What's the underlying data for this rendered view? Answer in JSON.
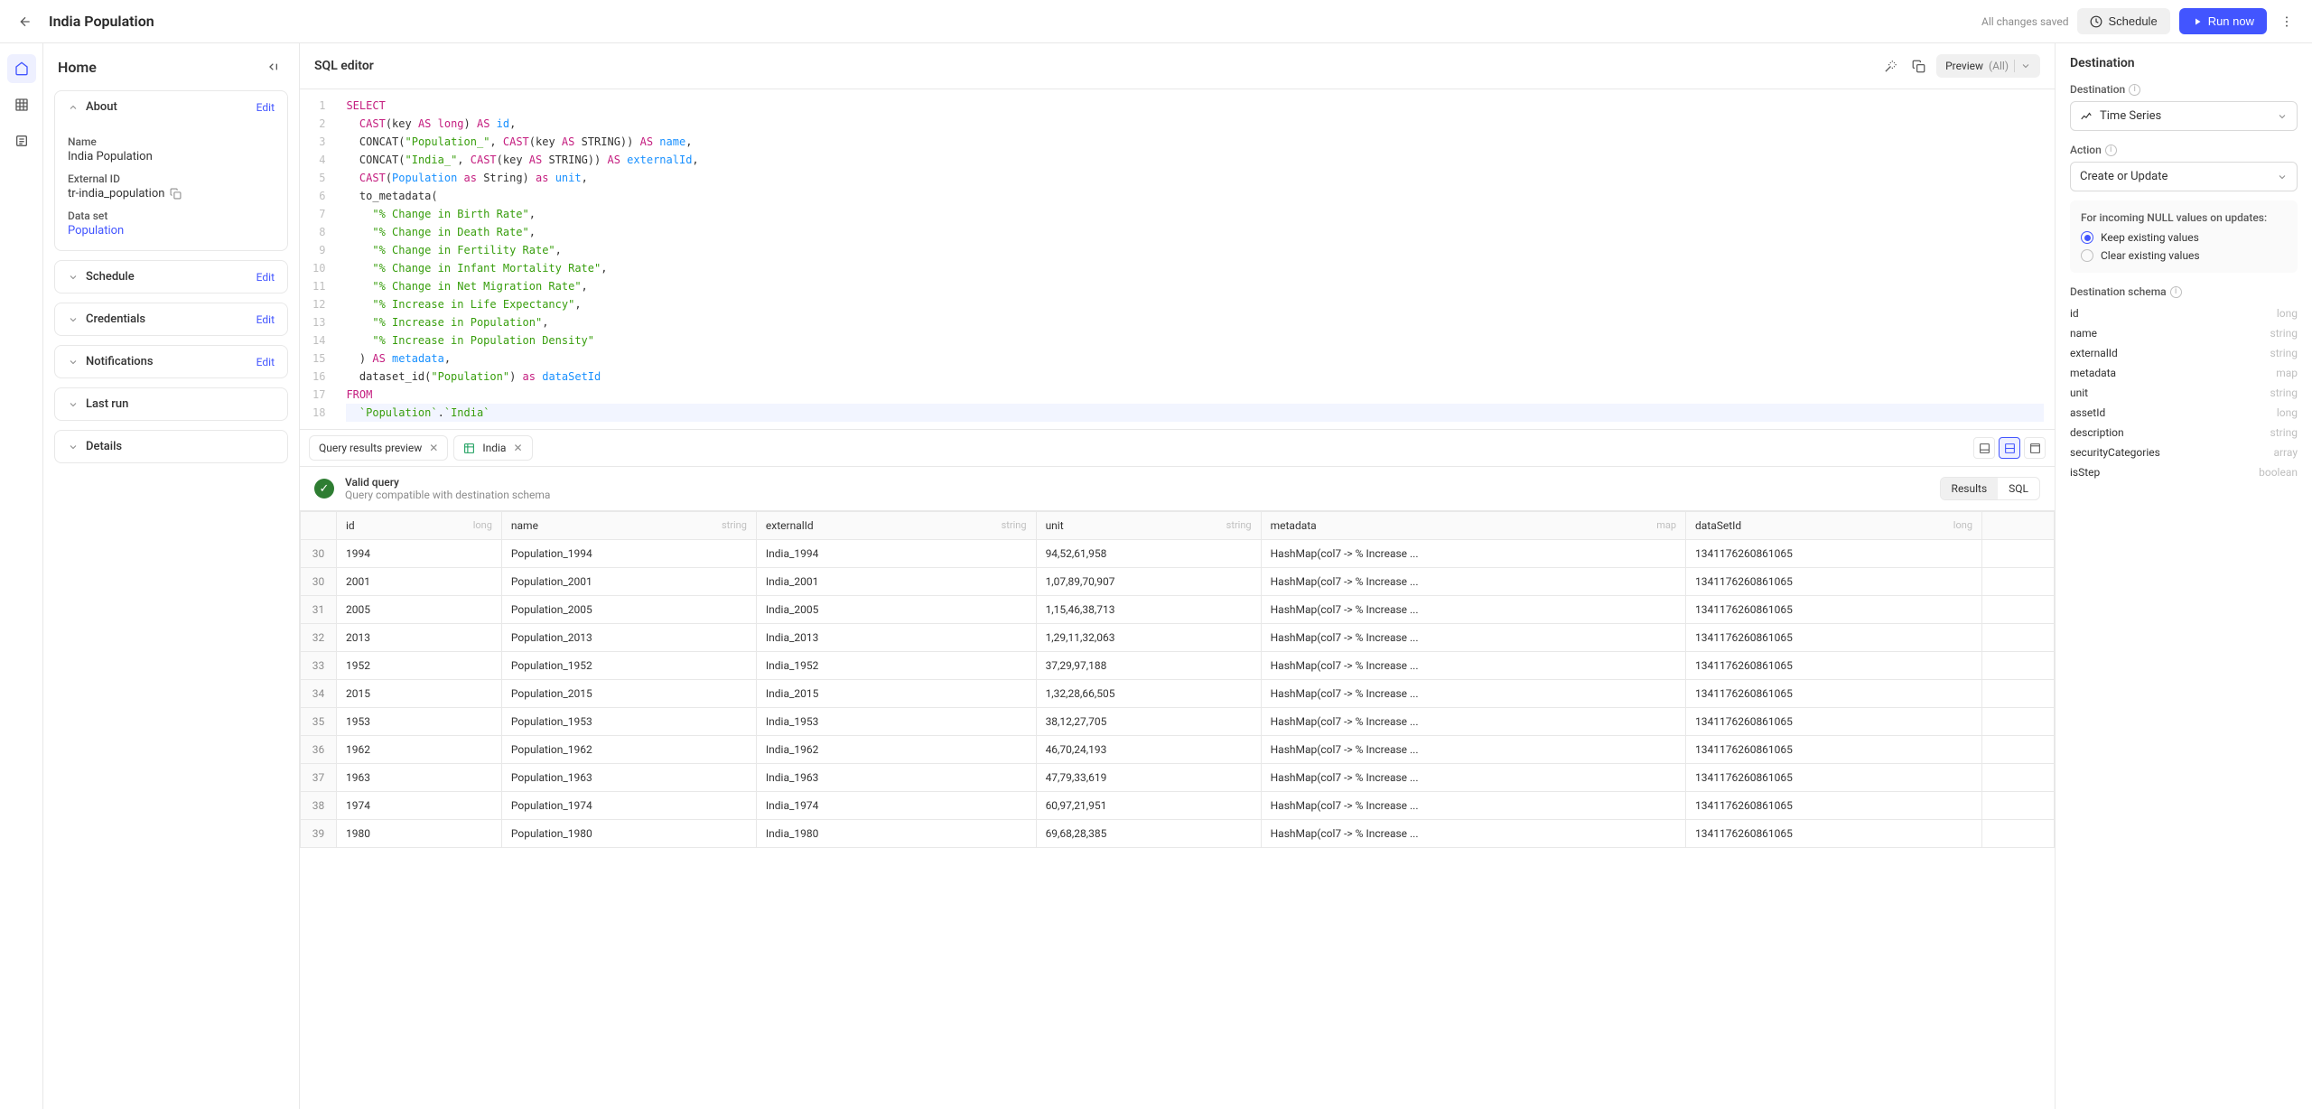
{
  "topbar": {
    "title": "India Population",
    "save_status": "All changes saved",
    "schedule_label": "Schedule",
    "run_label": "Run now"
  },
  "sidebar": {
    "heading": "Home",
    "sections": {
      "about": {
        "title": "About",
        "edit": "Edit",
        "name_label": "Name",
        "name_value": "India Population",
        "extid_label": "External ID",
        "extid_value": "tr-india_population",
        "dataset_label": "Data set",
        "dataset_value": "Population"
      },
      "schedule": {
        "title": "Schedule",
        "edit": "Edit"
      },
      "credentials": {
        "title": "Credentials",
        "edit": "Edit"
      },
      "notifications": {
        "title": "Notifications",
        "edit": "Edit"
      },
      "lastrun": {
        "title": "Last run"
      },
      "details": {
        "title": "Details"
      }
    }
  },
  "editor": {
    "heading": "SQL editor",
    "preview_label": "Preview",
    "preview_scope": "(All)",
    "lines": [
      {
        "n": 1,
        "html": "<span class='kw'>SELECT</span>"
      },
      {
        "n": 2,
        "html": "  <span class='kw'>CAST</span>(key <span class='kw'>AS</span> <span class='kw'>long</span>) <span class='kw'>AS</span> <span class='id2'>id</span>,"
      },
      {
        "n": 3,
        "html": "  <span class='fn'>CONCAT</span>(<span class='str'>\"Population_\"</span>, <span class='kw'>CAST</span>(key <span class='kw'>AS</span> STRING)) <span class='kw'>AS</span> <span class='id2'>name</span>,"
      },
      {
        "n": 4,
        "html": "  <span class='fn'>CONCAT</span>(<span class='str'>\"India_\"</span>, <span class='kw'>CAST</span>(key <span class='kw'>AS</span> STRING)) <span class='kw'>AS</span> <span class='id2'>externalId</span>,"
      },
      {
        "n": 5,
        "html": "  <span class='kw'>CAST</span>(<span class='id2'>Population</span> <span class='kw'>as</span> String) <span class='kw'>as</span> <span class='id2'>unit</span>,"
      },
      {
        "n": 6,
        "html": "  to_metadata("
      },
      {
        "n": 7,
        "html": "    <span class='str'>\"% Change in Birth Rate\"</span>,"
      },
      {
        "n": 8,
        "html": "    <span class='str'>\"% Change in Death Rate\"</span>,"
      },
      {
        "n": 9,
        "html": "    <span class='str'>\"% Change in Fertility Rate\"</span>,"
      },
      {
        "n": 10,
        "html": "    <span class='str'>\"% Change in Infant Mortality Rate\"</span>,"
      },
      {
        "n": 11,
        "html": "    <span class='str'>\"% Change in Net Migration Rate\"</span>,"
      },
      {
        "n": 12,
        "html": "    <span class='str'>\"% Increase in Life Expectancy\"</span>,"
      },
      {
        "n": 13,
        "html": "    <span class='str'>\"% Increase in Population\"</span>,"
      },
      {
        "n": 14,
        "html": "    <span class='str'>\"% Increase in Population Density\"</span>"
      },
      {
        "n": 15,
        "html": "  ) <span class='kw'>AS</span> <span class='id2'>metadata</span>,"
      },
      {
        "n": 16,
        "html": "  dataset_id(<span class='str'>\"Population\"</span>) <span class='kw'>as</span> <span class='id2'>dataSetId</span>"
      },
      {
        "n": 17,
        "html": "<span class='kw'>FROM</span>"
      },
      {
        "n": 18,
        "html": "  <span class='str'>`Population`</span>.<span class='str'>`India`</span>",
        "hl": true
      }
    ]
  },
  "results": {
    "tab1": "Query results preview",
    "tab2": "India",
    "valid_title": "Valid query",
    "valid_sub": "Query compatible with destination schema",
    "view_results": "Results",
    "view_sql": "SQL",
    "columns": [
      {
        "name": "id",
        "type": "long"
      },
      {
        "name": "name",
        "type": "string"
      },
      {
        "name": "externalId",
        "type": "string"
      },
      {
        "name": "unit",
        "type": "string"
      },
      {
        "name": "metadata",
        "type": "map"
      },
      {
        "name": "dataSetId",
        "type": "long"
      }
    ],
    "rows": [
      {
        "n": 30,
        "id": "1994",
        "name": "Population_1994",
        "ext": "India_1994",
        "unit": "94,52,61,958",
        "meta": "HashMap(col7 -> % Increase ...",
        "ds": "1341176260861065"
      },
      {
        "n": 30,
        "id": "2001",
        "name": "Population_2001",
        "ext": "India_2001",
        "unit": "1,07,89,70,907",
        "meta": "HashMap(col7 -> % Increase ...",
        "ds": "1341176260861065"
      },
      {
        "n": 31,
        "id": "2005",
        "name": "Population_2005",
        "ext": "India_2005",
        "unit": "1,15,46,38,713",
        "meta": "HashMap(col7 -> % Increase ...",
        "ds": "1341176260861065"
      },
      {
        "n": 32,
        "id": "2013",
        "name": "Population_2013",
        "ext": "India_2013",
        "unit": "1,29,11,32,063",
        "meta": "HashMap(col7 -> % Increase ...",
        "ds": "1341176260861065"
      },
      {
        "n": 33,
        "id": "1952",
        "name": "Population_1952",
        "ext": "India_1952",
        "unit": "37,29,97,188",
        "meta": "HashMap(col7 -> % Increase ...",
        "ds": "1341176260861065"
      },
      {
        "n": 34,
        "id": "2015",
        "name": "Population_2015",
        "ext": "India_2015",
        "unit": "1,32,28,66,505",
        "meta": "HashMap(col7 -> % Increase ...",
        "ds": "1341176260861065"
      },
      {
        "n": 35,
        "id": "1953",
        "name": "Population_1953",
        "ext": "India_1953",
        "unit": "38,12,27,705",
        "meta": "HashMap(col7 -> % Increase ...",
        "ds": "1341176260861065"
      },
      {
        "n": 36,
        "id": "1962",
        "name": "Population_1962",
        "ext": "India_1962",
        "unit": "46,70,24,193",
        "meta": "HashMap(col7 -> % Increase ...",
        "ds": "1341176260861065"
      },
      {
        "n": 37,
        "id": "1963",
        "name": "Population_1963",
        "ext": "India_1963",
        "unit": "47,79,33,619",
        "meta": "HashMap(col7 -> % Increase ...",
        "ds": "1341176260861065"
      },
      {
        "n": 38,
        "id": "1974",
        "name": "Population_1974",
        "ext": "India_1974",
        "unit": "60,97,21,951",
        "meta": "HashMap(col7 -> % Increase ...",
        "ds": "1341176260861065"
      },
      {
        "n": 39,
        "id": "1980",
        "name": "Population_1980",
        "ext": "India_1980",
        "unit": "69,68,28,385",
        "meta": "HashMap(col7 -> % Increase ...",
        "ds": "1341176260861065"
      }
    ]
  },
  "dest": {
    "heading": "Destination",
    "dest_label": "Destination",
    "dest_value": "Time Series",
    "action_label": "Action",
    "action_value": "Create or Update",
    "null_header": "For incoming NULL values on updates:",
    "null_keep": "Keep existing values",
    "null_clear": "Clear existing values",
    "schema_label": "Destination schema",
    "schema": [
      {
        "name": "id",
        "type": "long"
      },
      {
        "name": "name",
        "type": "string"
      },
      {
        "name": "externalId",
        "type": "string"
      },
      {
        "name": "metadata",
        "type": "map"
      },
      {
        "name": "unit",
        "type": "string"
      },
      {
        "name": "assetId",
        "type": "long"
      },
      {
        "name": "description",
        "type": "string"
      },
      {
        "name": "securityCategories",
        "type": "array"
      },
      {
        "name": "isStep",
        "type": "boolean"
      }
    ]
  }
}
